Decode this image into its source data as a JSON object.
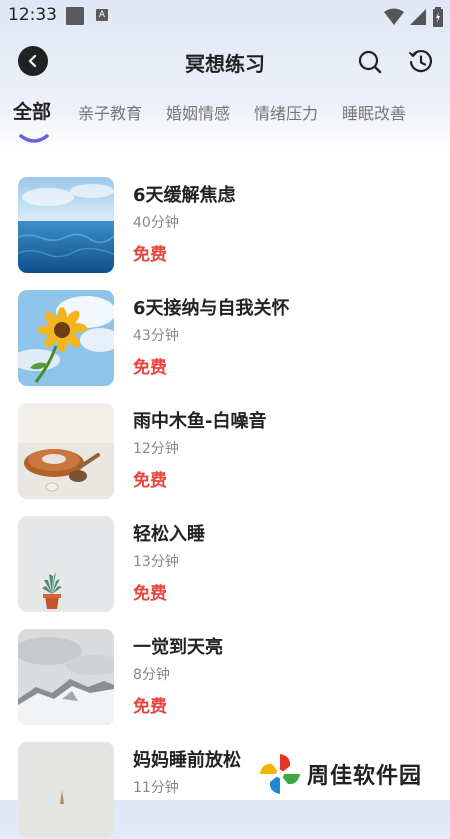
{
  "status_bar": {
    "time": "12:33",
    "notification_letter": "A",
    "icons": [
      "wifi-icon",
      "signal-icon",
      "battery-icon"
    ]
  },
  "header": {
    "title": "冥想练习",
    "icons": [
      "back-arrow-icon",
      "search-icon",
      "history-clock-icon"
    ]
  },
  "tabs": [
    {
      "label": "全部",
      "active": true
    },
    {
      "label": "亲子教育",
      "active": false
    },
    {
      "label": "婚姻情感",
      "active": false
    },
    {
      "label": "情绪压力",
      "active": false
    },
    {
      "label": "睡眠改善",
      "active": false
    }
  ],
  "items": [
    {
      "title": "6天缓解焦虑",
      "duration": "40分钟",
      "price": "免费",
      "thumbnail": "ocean"
    },
    {
      "title": "6天接纳与自我关怀",
      "duration": "43分钟",
      "price": "免费",
      "thumbnail": "sunflower"
    },
    {
      "title": "雨中木鱼-白噪音",
      "duration": "12分钟",
      "price": "免费",
      "thumbnail": "wooden-fish"
    },
    {
      "title": "轻松入睡",
      "duration": "13分钟",
      "price": "免费",
      "thumbnail": "succulent"
    },
    {
      "title": "一觉到天亮",
      "duration": "8分钟",
      "price": "免费",
      "thumbnail": "snowy-mountain"
    },
    {
      "title": "妈妈睡前放松",
      "duration": "11分钟",
      "price": "",
      "thumbnail": "light-wall"
    }
  ],
  "watermark": {
    "text": "周佳软件园"
  },
  "colors": {
    "price": "#e8453d",
    "tab_indicator": "#6b5fe0",
    "back_button": "#1f2323"
  }
}
